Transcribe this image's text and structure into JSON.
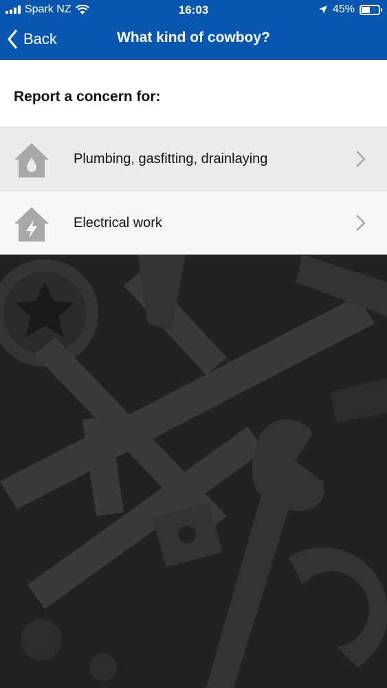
{
  "status_bar": {
    "carrier": "Spark NZ",
    "time": "16:03",
    "battery": "45%",
    "battery_level": 0.45,
    "icons": [
      "signal-icon",
      "wifi-icon",
      "location-icon",
      "battery-icon"
    ]
  },
  "nav": {
    "back_label": "Back",
    "title": "What kind of cowboy?"
  },
  "section": {
    "title": "Report a concern for:"
  },
  "options": [
    {
      "label": "Plumbing, gasfitting, drainlaying",
      "icon": "house-water-drop-icon"
    },
    {
      "label": "Electrical work",
      "icon": "house-lightning-icon"
    }
  ],
  "colors": {
    "header": "#0757b0",
    "row_icon": "#a8a8a8",
    "chevron": "#b0b0b0",
    "background": "#232323"
  }
}
